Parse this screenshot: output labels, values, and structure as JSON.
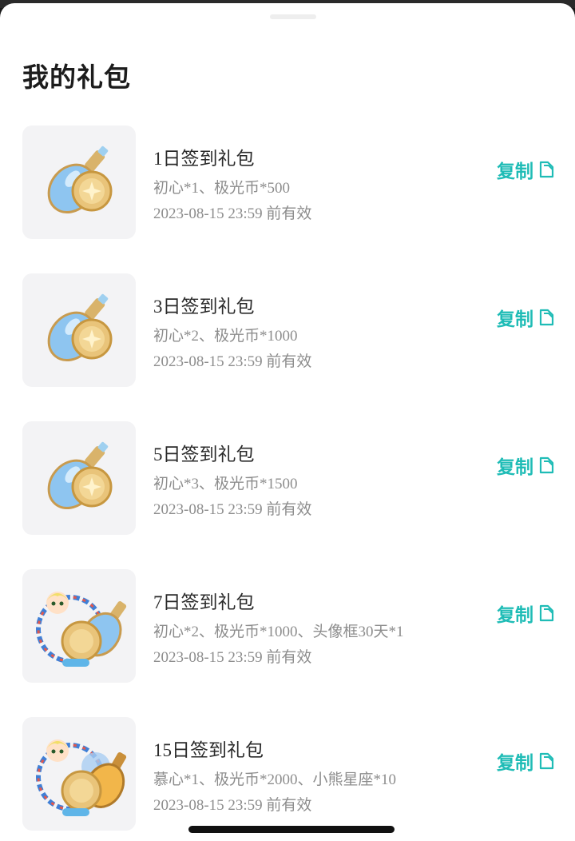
{
  "sheet": {
    "title": "我的礼包"
  },
  "gifts": [
    {
      "name": "1日签到礼包",
      "contents": "初心*1、极光币*500",
      "expiry": "2023-08-15 23:59 前有效",
      "copy_label": "复制",
      "icon": "potion-and-coin-icon"
    },
    {
      "name": "3日签到礼包",
      "contents": "初心*2、极光币*1000",
      "expiry": "2023-08-15 23:59 前有效",
      "copy_label": "复制",
      "icon": "potion-and-coin-icon"
    },
    {
      "name": "5日签到礼包",
      "contents": "初心*3、极光币*1500",
      "expiry": "2023-08-15 23:59 前有效",
      "copy_label": "复制",
      "icon": "potion-and-coin-icon"
    },
    {
      "name": "7日签到礼包",
      "contents": "初心*2、极光币*1000、头像框30天*1",
      "expiry": "2023-08-15 23:59 前有效",
      "copy_label": "复制",
      "icon": "avatar-frame-bundle-icon"
    },
    {
      "name": "15日签到礼包",
      "contents": "慕心*1、极光币*2000、小熊星座*10",
      "expiry": "2023-08-15 23:59 前有效",
      "copy_label": "复制",
      "icon": "avatar-frame-golden-bundle-icon"
    }
  ],
  "colors": {
    "accent": "#1fbcb6",
    "thumb_bg": "#f3f3f5",
    "secondary_text": "#8d8d8d"
  }
}
